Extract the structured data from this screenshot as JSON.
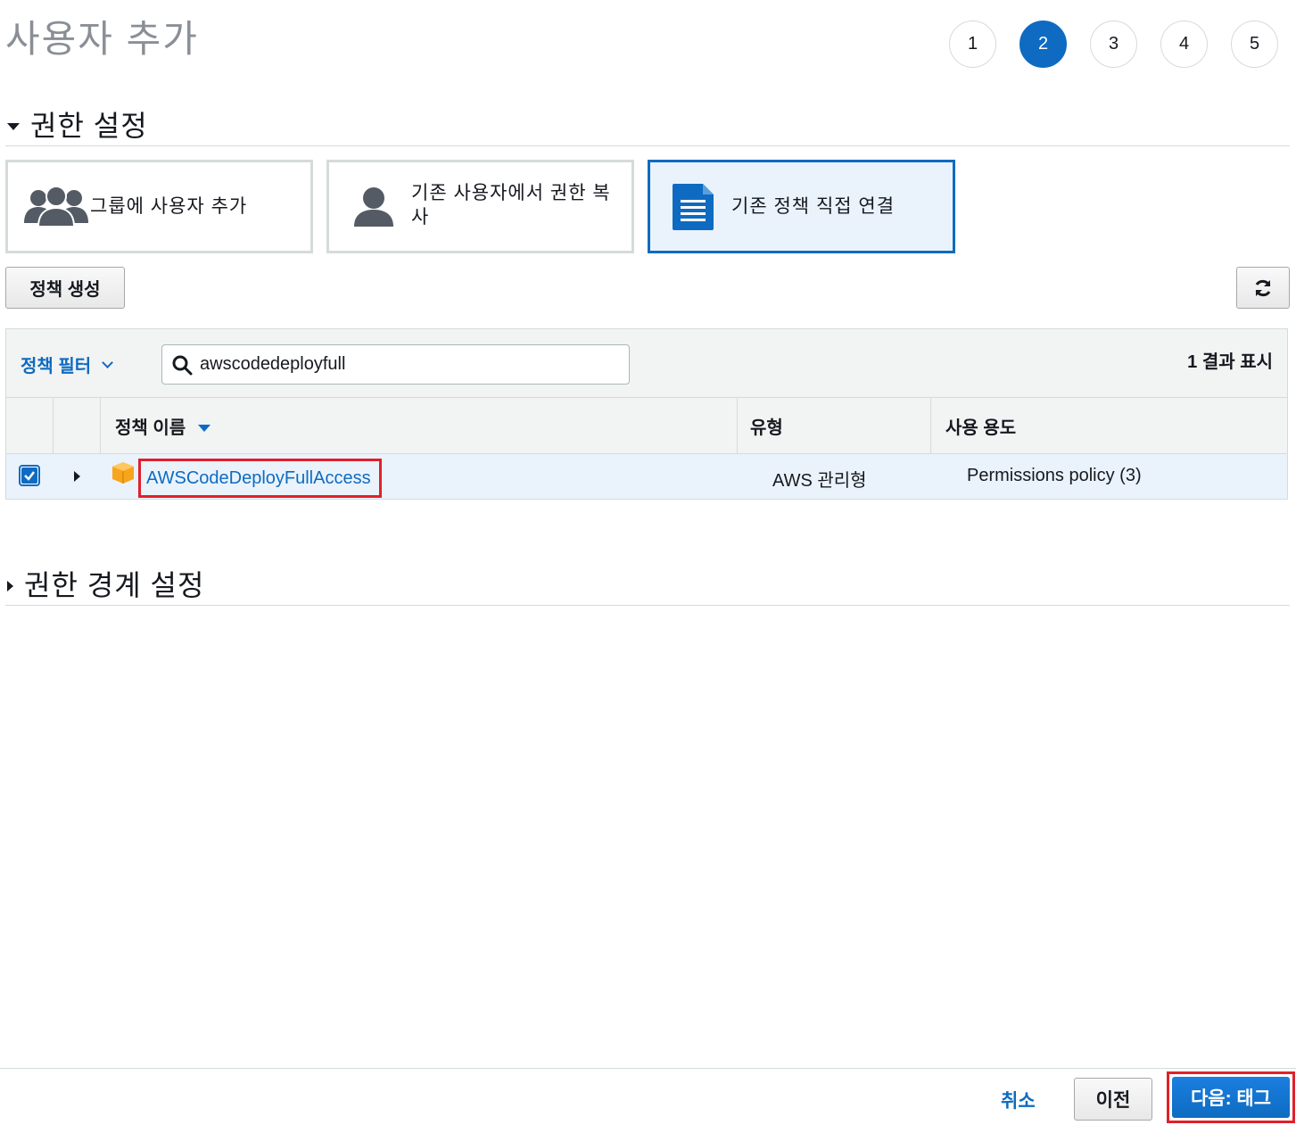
{
  "page": {
    "title": "사용자 추가"
  },
  "steps": [
    "1",
    "2",
    "3",
    "4",
    "5"
  ],
  "active_step": "2",
  "permissions_section": {
    "title": "권한 설정"
  },
  "options": [
    {
      "label": "그룹에 사용자 추가",
      "icon": "users-group-icon"
    },
    {
      "label": "기존 사용자에서 권한 복사",
      "icon": "user-icon"
    },
    {
      "label": "기존 정책 직접 연결",
      "icon": "document-icon"
    }
  ],
  "create_policy_label": "정책 생성",
  "filter": {
    "label": "정책 필터",
    "search_value": "awscodedeployfull",
    "results": "1 결과 표시"
  },
  "table": {
    "headers": {
      "name": "정책 이름",
      "type": "유형",
      "usage": "사용 용도"
    },
    "rows": [
      {
        "checked": true,
        "name": "AWSCodeDeployFullAccess",
        "type": "AWS 관리형",
        "usage": "Permissions policy (3)"
      }
    ]
  },
  "boundary_section": {
    "title": "권한 경계 설정"
  },
  "footer": {
    "cancel": "취소",
    "previous": "이전",
    "next": "다음: 태그"
  },
  "colors": {
    "accent": "#0e6bc1",
    "highlight": "#e0202a",
    "row_selected": "#eaf3fc",
    "aws_orange": "#f7a51c"
  }
}
